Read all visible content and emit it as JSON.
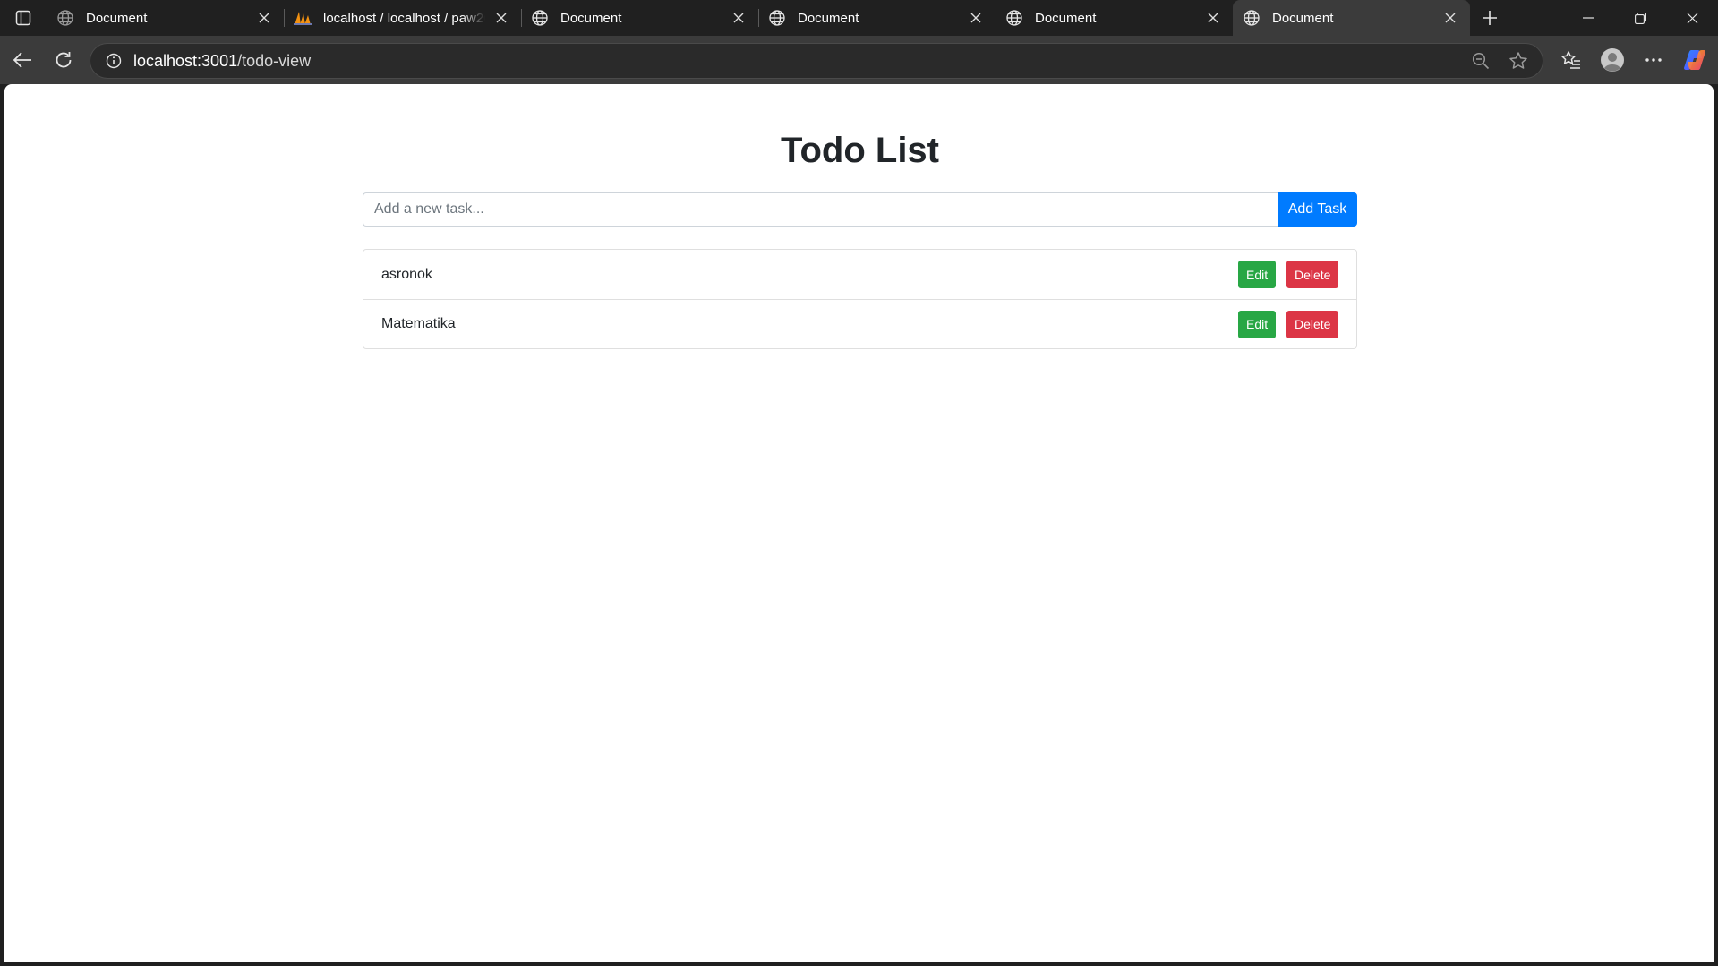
{
  "browser": {
    "tabs": [
      {
        "title": "Document",
        "favicon": "globe-icon",
        "active": false
      },
      {
        "title": "localhost / localhost / paw20",
        "favicon": "phpmyadmin-icon",
        "active": false
      },
      {
        "title": "Document",
        "favicon": "globe-icon",
        "active": false
      },
      {
        "title": "Document",
        "favicon": "globe-icon",
        "active": false
      },
      {
        "title": "Document",
        "favicon": "globe-icon",
        "active": false
      },
      {
        "title": "Document",
        "favicon": "globe-icon",
        "active": true
      }
    ],
    "address": {
      "host": "localhost:3001",
      "path": "/todo-view"
    },
    "colors": {
      "chrome_dark": "#202020",
      "toolbar": "#3b3b3b"
    }
  },
  "page": {
    "title": "Todo List",
    "input_placeholder": "Add a new task...",
    "add_button": "Add Task",
    "todos": [
      {
        "text": "asronok",
        "edit_label": "Edit",
        "delete_label": "Delete"
      },
      {
        "text": "Matematika",
        "edit_label": "Edit",
        "delete_label": "Delete"
      }
    ],
    "colors": {
      "primary": "#007bff",
      "success": "#28a745",
      "danger": "#dc3545"
    }
  }
}
